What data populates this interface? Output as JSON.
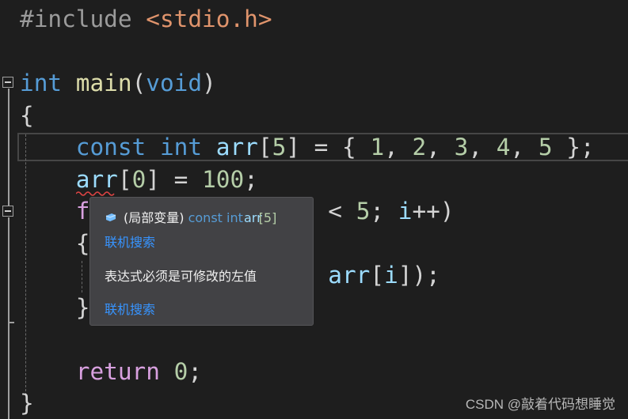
{
  "editor": {
    "colors": {
      "background": "#1e1e1e",
      "keyword": "#569cd6",
      "function": "#dcdcaa",
      "variable": "#9cdcfe",
      "number": "#b5cea8",
      "string": "#e0946c",
      "preprocessor": "#9b9b9b",
      "control": "#d8a0df"
    },
    "lines": [
      [
        {
          "t": "#include",
          "c": "pre"
        },
        {
          "t": " ",
          "c": "pun"
        },
        {
          "t": "<stdio.h>",
          "c": "str"
        }
      ],
      [],
      [
        {
          "t": "int",
          "c": "kw"
        },
        {
          "t": " ",
          "c": "pun"
        },
        {
          "t": "main",
          "c": "fn"
        },
        {
          "t": "(",
          "c": "pun"
        },
        {
          "t": "void",
          "c": "kw"
        },
        {
          "t": ")",
          "c": "pun"
        }
      ],
      [
        {
          "t": "{",
          "c": "pun"
        }
      ],
      [
        {
          "t": "    ",
          "c": "pun"
        },
        {
          "t": "const",
          "c": "kw"
        },
        {
          "t": " ",
          "c": "pun"
        },
        {
          "t": "int",
          "c": "kw"
        },
        {
          "t": " ",
          "c": "pun"
        },
        {
          "t": "arr",
          "c": "var"
        },
        {
          "t": "[",
          "c": "pun"
        },
        {
          "t": "5",
          "c": "num"
        },
        {
          "t": "] = { ",
          "c": "pun"
        },
        {
          "t": "1",
          "c": "num"
        },
        {
          "t": ", ",
          "c": "pun"
        },
        {
          "t": "2",
          "c": "num"
        },
        {
          "t": ", ",
          "c": "pun"
        },
        {
          "t": "3",
          "c": "num"
        },
        {
          "t": ", ",
          "c": "pun"
        },
        {
          "t": "4",
          "c": "num"
        },
        {
          "t": ", ",
          "c": "pun"
        },
        {
          "t": "5",
          "c": "num"
        },
        {
          "t": " };",
          "c": "pun"
        }
      ],
      [
        {
          "t": "    ",
          "c": "pun"
        },
        {
          "t": "arr",
          "c": "var"
        },
        {
          "t": "[",
          "c": "pun"
        },
        {
          "t": "0",
          "c": "num"
        },
        {
          "t": "] = ",
          "c": "pun"
        },
        {
          "t": "100",
          "c": "num"
        },
        {
          "t": ";",
          "c": "pun"
        }
      ],
      [
        {
          "t": "    ",
          "c": "pun"
        },
        {
          "t": "f",
          "c": "ctl"
        },
        {
          "t": "                 ",
          "c": "pun"
        },
        {
          "t": "< ",
          "c": "pun"
        },
        {
          "t": "5",
          "c": "num"
        },
        {
          "t": "; ",
          "c": "pun"
        },
        {
          "t": "i",
          "c": "var"
        },
        {
          "t": "++)",
          "c": "pun"
        }
      ],
      [
        {
          "t": "    ",
          "c": "pun"
        },
        {
          "t": "{",
          "c": "pun"
        }
      ],
      [
        {
          "t": "                      ",
          "c": "pun"
        },
        {
          "t": "arr",
          "c": "var"
        },
        {
          "t": "[",
          "c": "pun"
        },
        {
          "t": "i",
          "c": "var"
        },
        {
          "t": "]);",
          "c": "pun"
        }
      ],
      [
        {
          "t": "    ",
          "c": "pun"
        },
        {
          "t": "}",
          "c": "pun"
        }
      ],
      [],
      [
        {
          "t": "    ",
          "c": "pun"
        },
        {
          "t": "return",
          "c": "ctl"
        },
        {
          "t": " ",
          "c": "pun"
        },
        {
          "t": "0",
          "c": "num"
        },
        {
          "t": ";",
          "c": "pun"
        }
      ],
      [
        {
          "t": "}",
          "c": "pun"
        }
      ]
    ]
  },
  "tooltip": {
    "icon": "local-variable-icon",
    "signature_prefix": "(局部变量)",
    "signature_kw": "const int",
    "signature_name": "arr",
    "signature_suffix": "[5]",
    "link1": "联机搜索",
    "error_message": "表达式必须是可修改的左值",
    "link2": "联机搜索"
  },
  "watermark": "CSDN @敲着代码想睡觉"
}
